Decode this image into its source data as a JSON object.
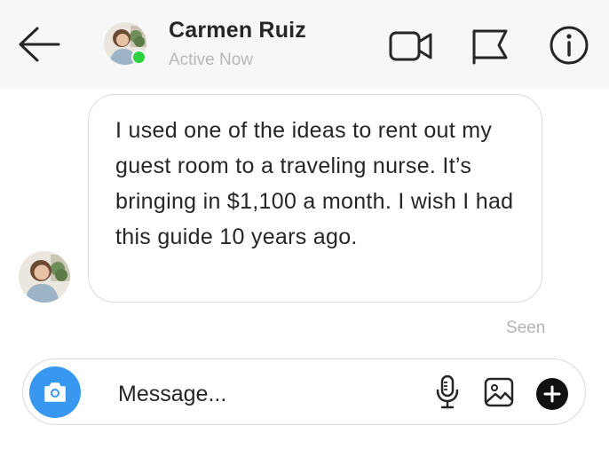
{
  "header": {
    "contact_name": "Carmen Ruiz",
    "status": "Active Now"
  },
  "thread": {
    "message_text": "I used one of the ideas to rent out my guest room to a traveling nurse. It’s bringing in $1,100 a month. I wish I had this guide 10 years ago.",
    "seen_label": "Seen"
  },
  "composer": {
    "placeholder": "Message..."
  },
  "colors": {
    "header_bg": "#f7f7f7",
    "online": "#2bd13e",
    "camera_button": "#3897f0",
    "muted_text": "#b7b7b7"
  },
  "icons": [
    "back-arrow-icon",
    "video-call-icon",
    "flag-icon",
    "info-icon",
    "camera-icon",
    "microphone-icon",
    "gallery-icon",
    "plus-icon"
  ]
}
